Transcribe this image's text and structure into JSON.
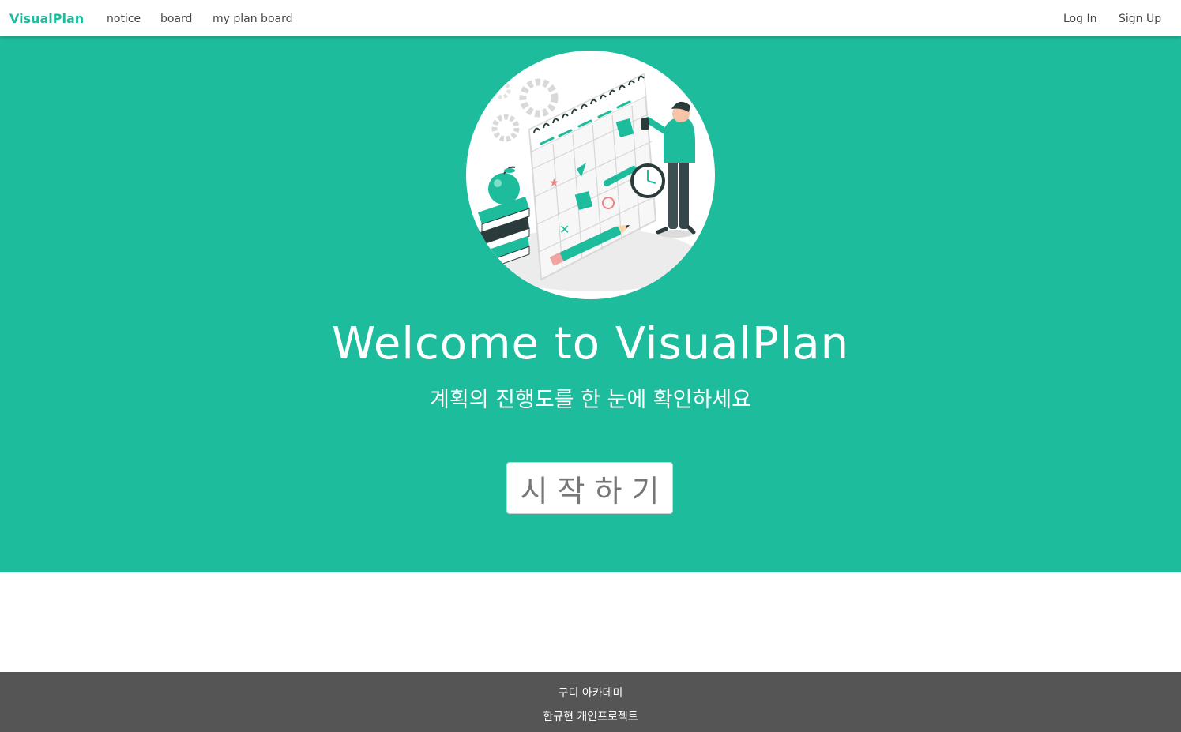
{
  "navbar": {
    "brand": "VisualPlan",
    "links": [
      "notice",
      "board",
      "my plan board"
    ],
    "login": "Log In",
    "signup": "Sign Up"
  },
  "hero": {
    "title": "Welcome to VisualPlan",
    "subtitle": "계획의 진행도를 한 눈에 확인하세요",
    "start_button": "시작하기",
    "illustration_icon": "calendar-planning-illustration"
  },
  "footer": {
    "line1": "구디 아카데미",
    "line2": "한규현 개인프로젝트"
  },
  "colors": {
    "brand": "#1abc9c",
    "hero_bg": "#1dbc9c",
    "footer_bg": "#555555"
  }
}
